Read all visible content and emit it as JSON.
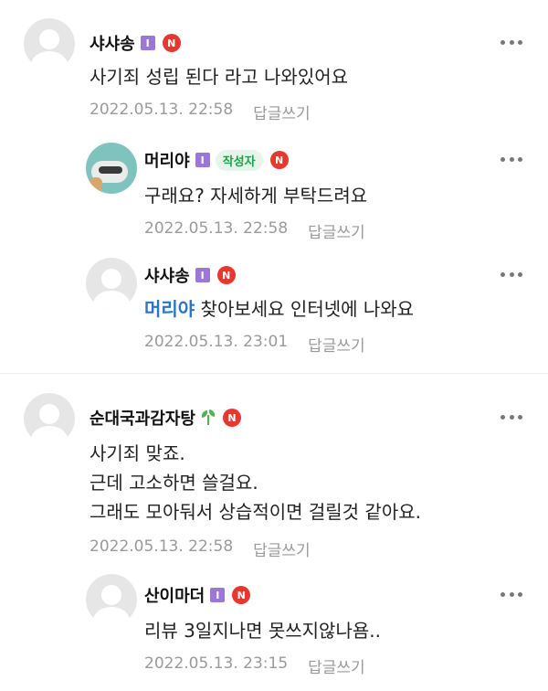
{
  "comments": [
    {
      "author": "샤샤송",
      "level": "I",
      "badge": "N",
      "text": "사기죄 성립 된다 라고 나와있어요",
      "date": "2022.05.13. 22:58",
      "reply_label": "답글쓰기"
    },
    {
      "author": "머리야",
      "level": "I",
      "author_tag": "작성자",
      "badge": "N",
      "text": "구래요? 자세하게 부탁드려요",
      "date": "2022.05.13. 22:58",
      "reply_label": "답글쓰기"
    },
    {
      "author": "샤샤송",
      "level": "I",
      "badge": "N",
      "mention": "머리야",
      "text": " 찾아보세요 인터넷에 나와요",
      "date": "2022.05.13. 23:01",
      "reply_label": "답글쓰기"
    },
    {
      "author": "순대국과감자탕",
      "badge": "N",
      "lines": [
        "사기죄 맞죠.",
        "근데 고소하면 쓸걸요.",
        "그래도 모아둬서 상습적이면 걸릴것 같아요."
      ],
      "date": "2022.05.13. 22:58",
      "reply_label": "답글쓰기"
    },
    {
      "author": "산이마더",
      "level": "I",
      "badge": "N",
      "text": "리뷰 3일지나면 못쓰지않나욤..",
      "date": "2022.05.13. 23:15",
      "reply_label": "답글쓰기"
    }
  ],
  "colors": {
    "accent_mention": "#2a74c9",
    "badge_red": "#e8372f",
    "level_purple": "#9b78d6",
    "author_tag_green": "#1aa14a"
  },
  "icons": {
    "more": "more-vertical-dots-icon",
    "sprout": "sprout-icon",
    "avatar_default": "default-avatar-icon"
  }
}
